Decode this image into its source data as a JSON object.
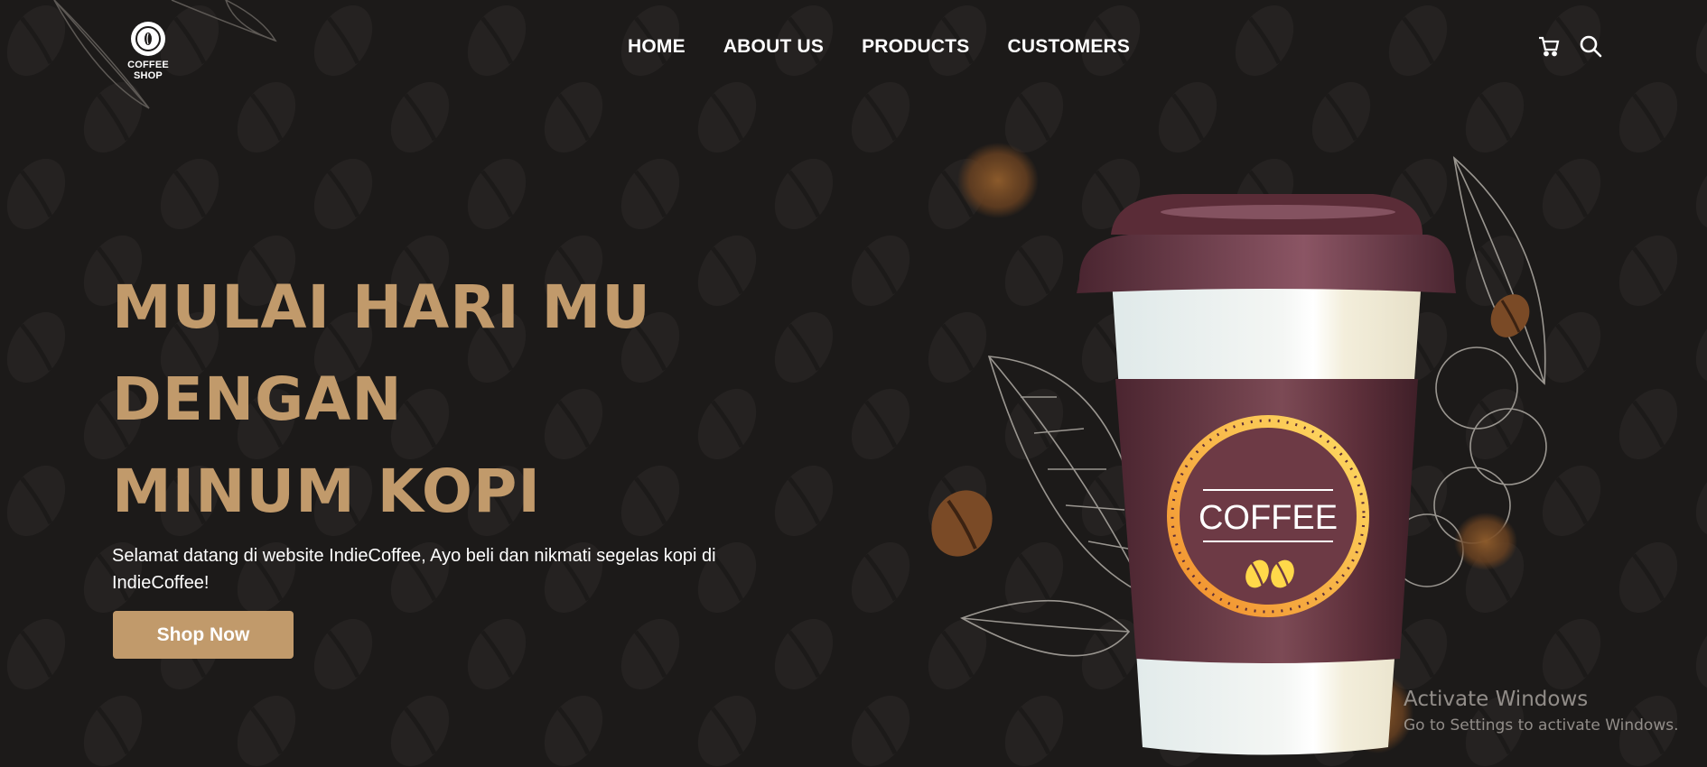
{
  "logo": {
    "text": "COFFEE SHOP",
    "mark": "0"
  },
  "nav": {
    "items": [
      "HOME",
      "ABOUT US",
      "PRODUCTS",
      "CUSTOMERS"
    ]
  },
  "icons": {
    "cart": "cart-icon",
    "search": "search-icon"
  },
  "hero": {
    "title_lines": [
      "MULAI HARI MU",
      "DENGAN",
      "MINUM KOPI"
    ],
    "subtitle": "Selamat datang di website IndieCoffee, Ayo beli dan nikmati segelas kopi di IndieCoffee!",
    "button": "Shop Now"
  },
  "cup": {
    "label": "COFFEE"
  },
  "watermark": {
    "line1": "Activate Windows",
    "line2": "Go to Settings to activate Windows."
  },
  "colors": {
    "background": "#1c1a19",
    "accent": "#c19a6b",
    "cup_sleeve": "#5e2f3a",
    "text": "#ffffff"
  }
}
